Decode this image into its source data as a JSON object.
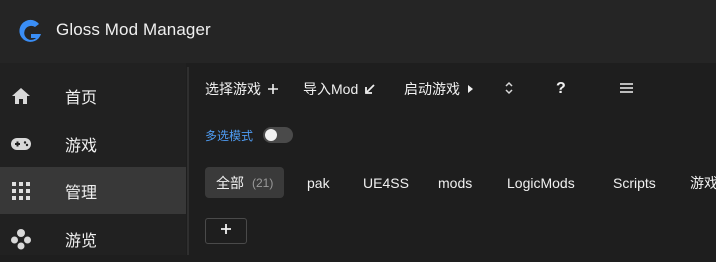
{
  "app": {
    "title": "Gloss Mod Manager"
  },
  "sidebar": {
    "items": [
      {
        "label": "首页",
        "icon": "home-icon"
      },
      {
        "label": "游戏",
        "icon": "gamepad-icon"
      },
      {
        "label": "管理",
        "icon": "grid-icon",
        "active": true
      },
      {
        "label": "游览",
        "icon": "cluster-icon"
      }
    ]
  },
  "toolbar": {
    "select_game": "选择游戏",
    "import_mod": "导入Mod",
    "launch_game": "启动游戏",
    "help": "?"
  },
  "multi_select": {
    "label": "多选模式",
    "enabled": false
  },
  "tags": [
    {
      "label": "全部",
      "count": "(21)",
      "active": true
    },
    {
      "label": "pak"
    },
    {
      "label": "UE4SS"
    },
    {
      "label": "mods"
    },
    {
      "label": "LogicMods"
    },
    {
      "label": "Scripts"
    },
    {
      "label": "游戏"
    }
  ],
  "colors": {
    "accent": "#4f9cf2",
    "logo": "#3a8ef6"
  }
}
